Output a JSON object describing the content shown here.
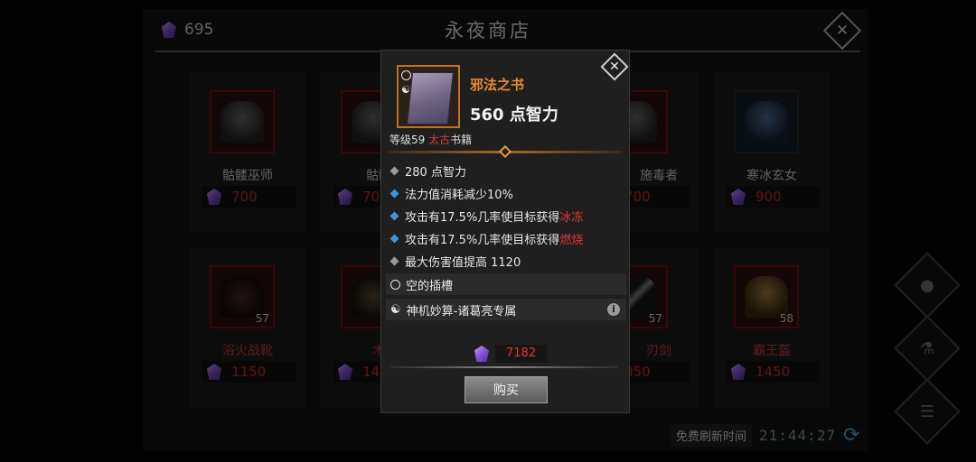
{
  "shop": {
    "title": "永夜商店",
    "gem_count": "695",
    "refresh_label": "免费刷新时间",
    "refresh_time": "21:44:27"
  },
  "items_row1": [
    {
      "name": "骷髅巫师",
      "price": "700"
    },
    {
      "name": "骷髅",
      "price": "70"
    },
    {
      "name": "施毒者",
      "price": "700"
    },
    {
      "name": "寒冰玄女",
      "price": "900"
    }
  ],
  "items_row2": [
    {
      "name": "浴火战靴",
      "price": "1150",
      "level": "57"
    },
    {
      "name": "木",
      "price": "14"
    },
    {
      "name": "刃剑",
      "price": "050",
      "level": "57"
    },
    {
      "name": "霸王盔",
      "price": "1450",
      "level": "58"
    }
  ],
  "popup": {
    "name": "邪法之书",
    "main_stat": "560 点智力",
    "level_label": "等级59",
    "rarity": "太古",
    "category": "书籍",
    "stats": [
      {
        "text": "280 点智力"
      },
      {
        "text": "法力值消耗减少10%"
      },
      {
        "text": "攻击有17.5%几率使目标获得",
        "hl": "冰冻"
      },
      {
        "text": "攻击有17.5%几率使目标获得",
        "hl": "燃烧"
      },
      {
        "text": "最大伤害值提高 1120"
      }
    ],
    "socket_text": "空的插槽",
    "set_text": "神机妙算-诸葛亮专属",
    "info_icon_text": "i",
    "price": "7182",
    "buy_label": "购买"
  },
  "colors": {
    "rarity_red": "#d93a3a",
    "item_name_orange": "#e9892c",
    "price_red": "#e23030",
    "magic_blue": "#3d94d8"
  }
}
